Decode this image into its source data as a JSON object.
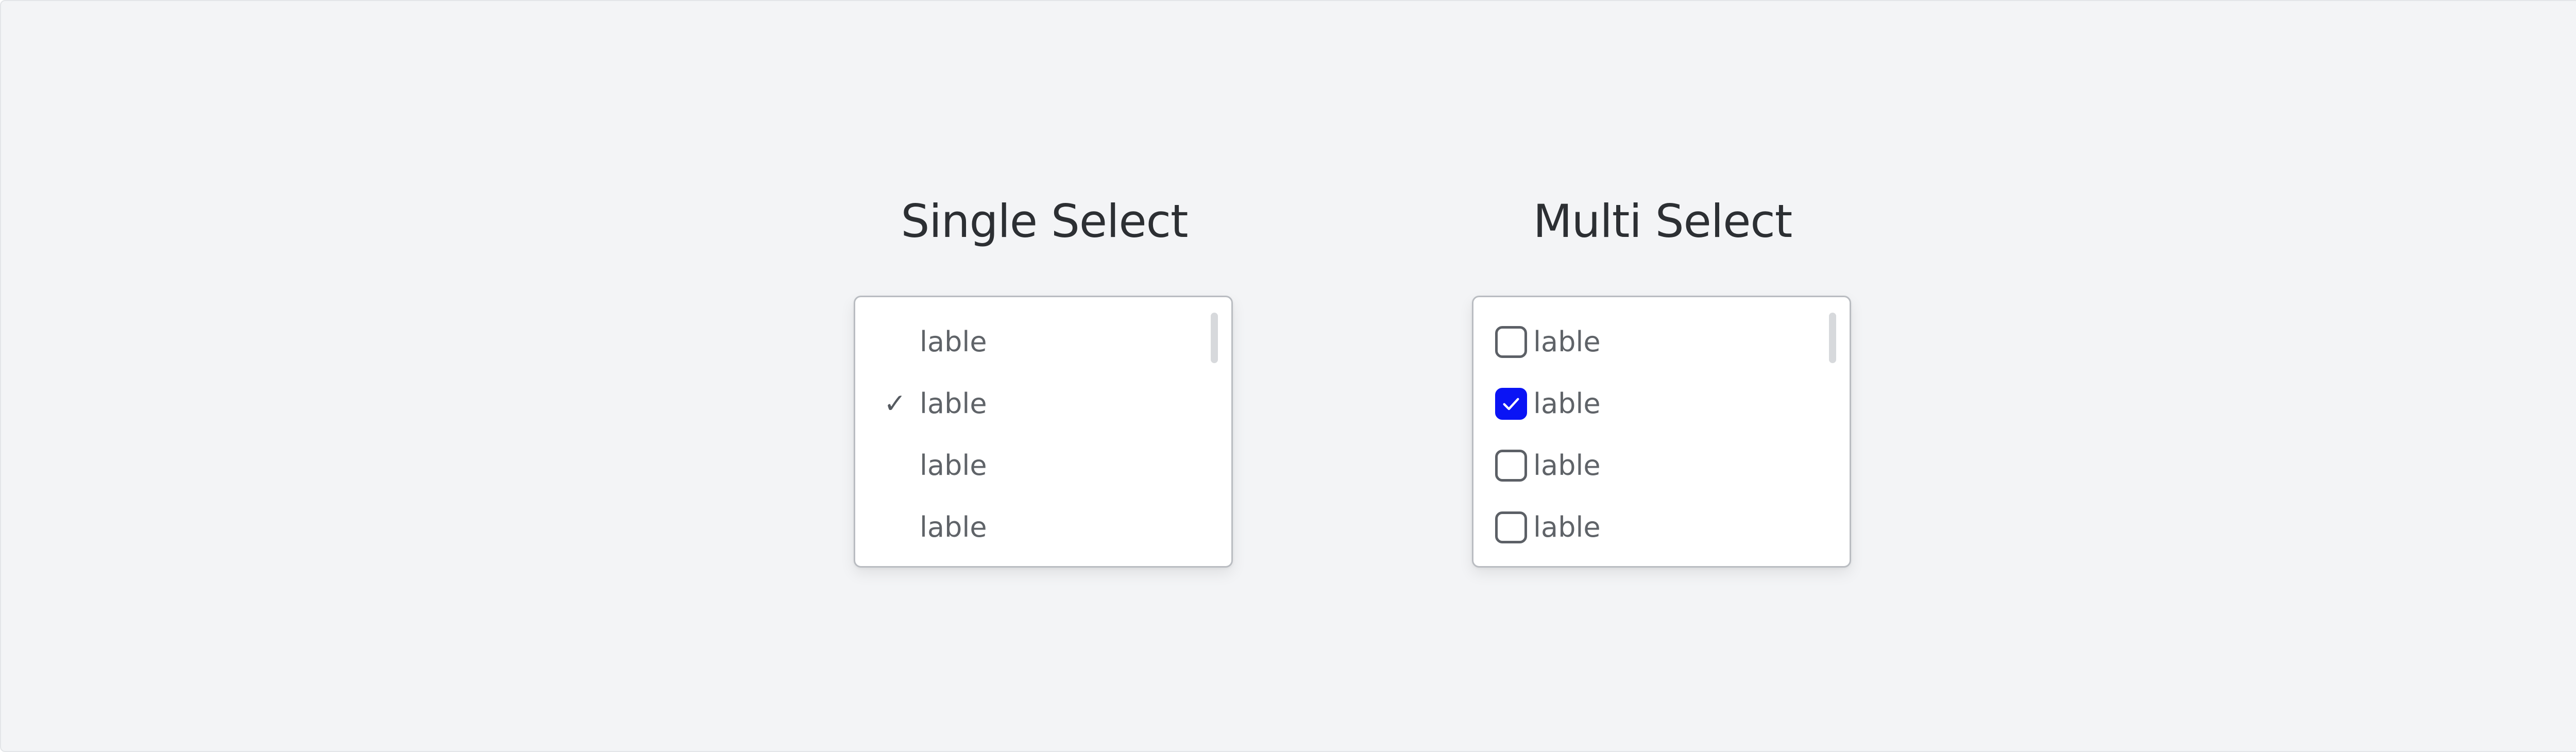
{
  "single_select": {
    "title": "Single Select",
    "options": [
      {
        "label": "lable",
        "selected": false
      },
      {
        "label": "lable",
        "selected": true
      },
      {
        "label": "lable",
        "selected": false
      },
      {
        "label": "lable",
        "selected": false
      }
    ],
    "checkmark_glyph": "✓"
  },
  "multi_select": {
    "title": "Multi Select",
    "options": [
      {
        "label": "lable",
        "checked": false
      },
      {
        "label": "lable",
        "checked": true
      },
      {
        "label": "lable",
        "checked": false
      },
      {
        "label": "lable",
        "checked": false
      }
    ]
  },
  "colors": {
    "background": "#f3f4f6",
    "checkbox_checked": "#0a14f5",
    "text_title": "#2c2f33",
    "text_option": "#5f6368"
  }
}
